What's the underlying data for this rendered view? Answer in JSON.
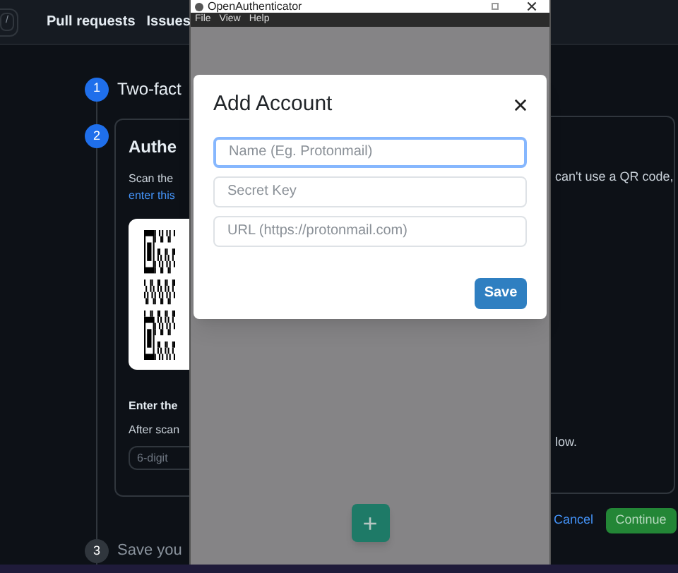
{
  "background_page": {
    "nav": {
      "shortcut_key": "/",
      "links": [
        "Pull requests",
        "Issues"
      ]
    },
    "steps": [
      {
        "number": "1",
        "title": "Two-fact",
        "active": true
      },
      {
        "number": "2",
        "title": "Authe",
        "active": true
      },
      {
        "number": "3",
        "title": "Save you",
        "active": false
      }
    ],
    "scan_text_start": "Scan the",
    "scan_text_end": "can't use a QR code,",
    "scan_link": "enter this",
    "code_heading": "Enter the",
    "code_text_start": "After scan",
    "code_text_end": "low.",
    "code_placeholder": "6-digit",
    "cancel": "Cancel",
    "continue": "Continue"
  },
  "window": {
    "title": "OpenAuthenticator",
    "menu": [
      "File",
      "View",
      "Help"
    ],
    "dialog": {
      "title": "Add Account",
      "fields": [
        {
          "placeholder": "Name (Eg. Protonmail)",
          "focused": true
        },
        {
          "placeholder": "Secret Key",
          "focused": false
        },
        {
          "placeholder": "URL (https://protonmail.com)",
          "focused": false
        }
      ],
      "button": "Save"
    },
    "fab": "+"
  }
}
